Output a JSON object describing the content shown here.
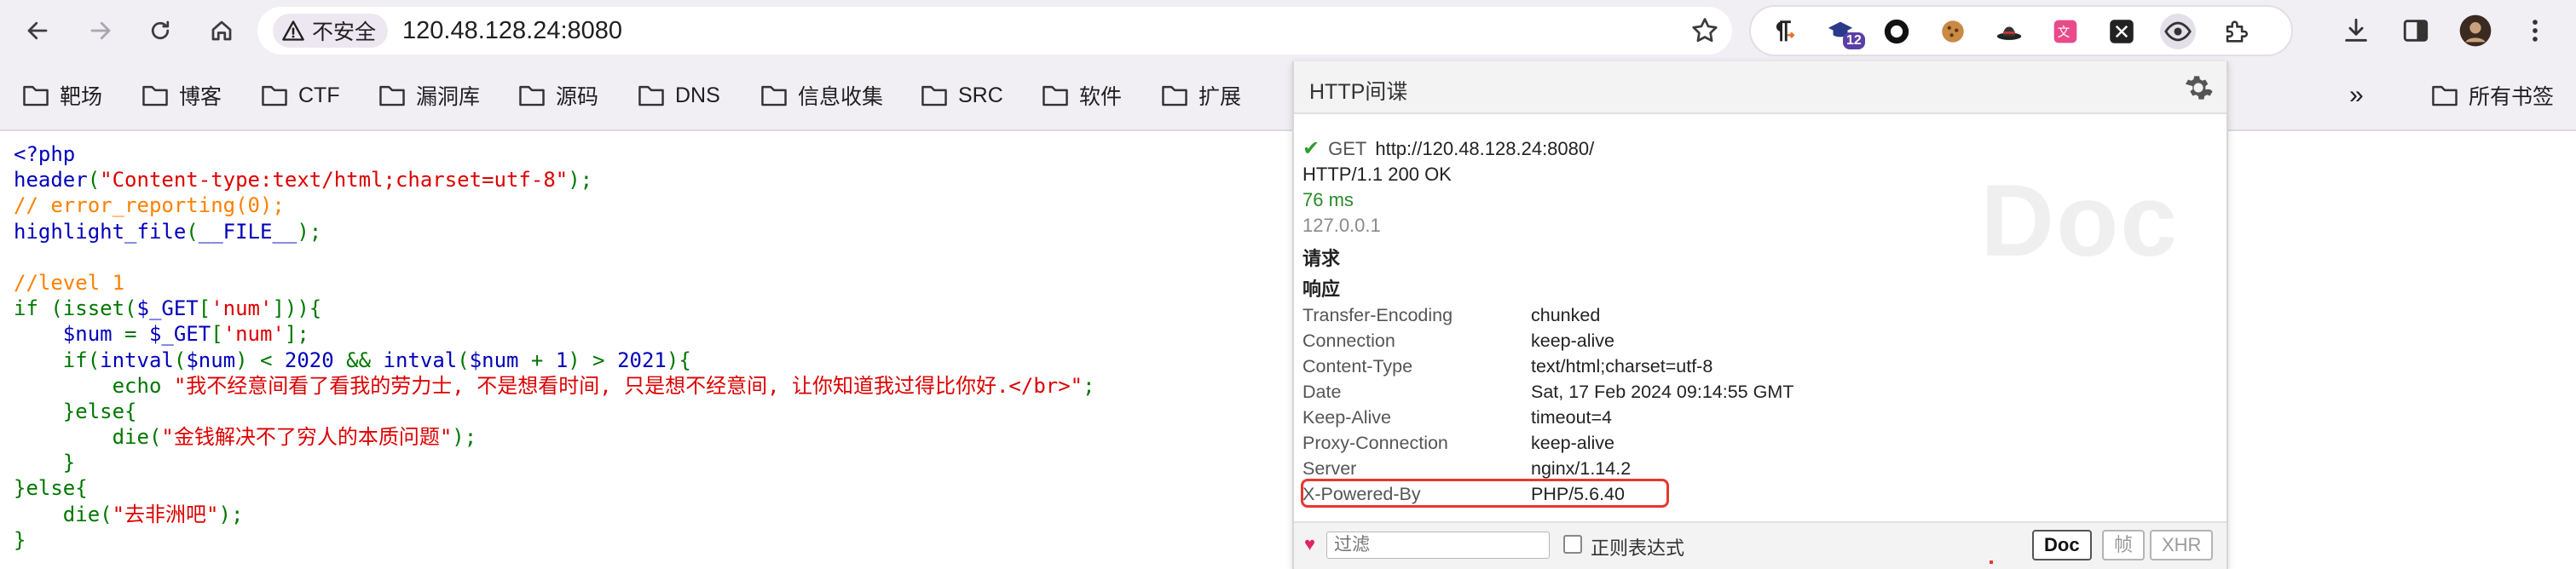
{
  "browser": {
    "security_label": "不安全",
    "url": "120.48.128.24:8080",
    "extension_badge": "12"
  },
  "bookmarks": {
    "items": [
      "靶场",
      "博客",
      "CTF",
      "漏洞库",
      "源码",
      "DNS",
      "信息收集",
      "SRC",
      "软件",
      "扩展"
    ],
    "all_bookmarks": "所有书签",
    "more": "»"
  },
  "code": {
    "lines": [
      [
        {
          "t": "<?php",
          "c": "c-def"
        }
      ],
      [
        {
          "t": "header",
          "c": "c-def"
        },
        {
          "t": "(",
          "c": "c-kw"
        },
        {
          "t": "\"Content-type:text/html;charset=utf-8\"",
          "c": "c-str"
        },
        {
          "t": ");",
          "c": "c-kw"
        }
      ],
      [
        {
          "t": "// error_reporting(0);",
          "c": "c-cmt"
        }
      ],
      [
        {
          "t": "highlight_file",
          "c": "c-def"
        },
        {
          "t": "(",
          "c": "c-kw"
        },
        {
          "t": "__FILE__",
          "c": "c-def"
        },
        {
          "t": ");",
          "c": "c-kw"
        }
      ],
      [
        {
          "t": "",
          "c": "c-def"
        }
      ],
      [
        {
          "t": "//level 1",
          "c": "c-cmt"
        }
      ],
      [
        {
          "t": "if (isset(",
          "c": "c-kw"
        },
        {
          "t": "$_GET",
          "c": "c-def"
        },
        {
          "t": "[",
          "c": "c-kw"
        },
        {
          "t": "'num'",
          "c": "c-str"
        },
        {
          "t": "])){",
          "c": "c-kw"
        }
      ],
      [
        {
          "t": "    ",
          "c": "c-def"
        },
        {
          "t": "$num ",
          "c": "c-def"
        },
        {
          "t": "= ",
          "c": "c-kw"
        },
        {
          "t": "$_GET",
          "c": "c-def"
        },
        {
          "t": "[",
          "c": "c-kw"
        },
        {
          "t": "'num'",
          "c": "c-str"
        },
        {
          "t": "];",
          "c": "c-kw"
        }
      ],
      [
        {
          "t": "    if(",
          "c": "c-kw"
        },
        {
          "t": "intval",
          "c": "c-def"
        },
        {
          "t": "(",
          "c": "c-kw"
        },
        {
          "t": "$num",
          "c": "c-def"
        },
        {
          "t": ") < ",
          "c": "c-kw"
        },
        {
          "t": "2020 ",
          "c": "c-def"
        },
        {
          "t": "&& ",
          "c": "c-kw"
        },
        {
          "t": "intval",
          "c": "c-def"
        },
        {
          "t": "(",
          "c": "c-kw"
        },
        {
          "t": "$num ",
          "c": "c-def"
        },
        {
          "t": "+ ",
          "c": "c-kw"
        },
        {
          "t": "1",
          "c": "c-def"
        },
        {
          "t": ") > ",
          "c": "c-kw"
        },
        {
          "t": "2021",
          "c": "c-def"
        },
        {
          "t": "){",
          "c": "c-kw"
        }
      ],
      [
        {
          "t": "        echo ",
          "c": "c-kw"
        },
        {
          "t": "\"我不经意间看了看我的劳力士, 不是想看时间, 只是想不经意间, 让你知道我过得比你好.</br>\"",
          "c": "c-str"
        },
        {
          "t": ";",
          "c": "c-kw"
        }
      ],
      [
        {
          "t": "    }else{",
          "c": "c-kw"
        }
      ],
      [
        {
          "t": "        die(",
          "c": "c-kw"
        },
        {
          "t": "\"金钱解决不了穷人的本质问题\"",
          "c": "c-str"
        },
        {
          "t": ");",
          "c": "c-kw"
        }
      ],
      [
        {
          "t": "    }",
          "c": "c-kw"
        }
      ],
      [
        {
          "t": "}else{",
          "c": "c-kw"
        }
      ],
      [
        {
          "t": "    die(",
          "c": "c-kw"
        },
        {
          "t": "\"去非洲吧\"",
          "c": "c-str"
        },
        {
          "t": ");",
          "c": "c-kw"
        }
      ],
      [
        {
          "t": "}",
          "c": "c-kw"
        }
      ]
    ]
  },
  "panel": {
    "title": "HTTP间谍",
    "watermark": "Doc",
    "method": "GET",
    "request_url": "http://120.48.128.24:8080/",
    "status_line": "HTTP/1.1 200 OK",
    "time": "76 ms",
    "ip": "127.0.0.1",
    "request_section": "请求",
    "response_section": "响应",
    "headers": [
      {
        "k": "Transfer-Encoding",
        "v": "chunked"
      },
      {
        "k": "Connection",
        "v": "keep-alive"
      },
      {
        "k": "Content-Type",
        "v": "text/html;charset=utf-8"
      },
      {
        "k": "Date",
        "v": "Sat, 17 Feb 2024 09:14:55 GMT"
      },
      {
        "k": "Keep-Alive",
        "v": "timeout=4"
      },
      {
        "k": "Proxy-Connection",
        "v": "keep-alive"
      },
      {
        "k": "Server",
        "v": "nginx/1.14.2"
      },
      {
        "k": "X-Powered-By",
        "v": "PHP/5.6.40"
      }
    ],
    "filter_placeholder": "过滤",
    "regex_label": "正则表达式",
    "buttons": {
      "doc": "Doc",
      "frame": "帧",
      "xhr": "XHR"
    },
    "heart": "♥",
    "colors": {
      "highlight": "#e8372c",
      "time": "#2a8a2a"
    }
  }
}
